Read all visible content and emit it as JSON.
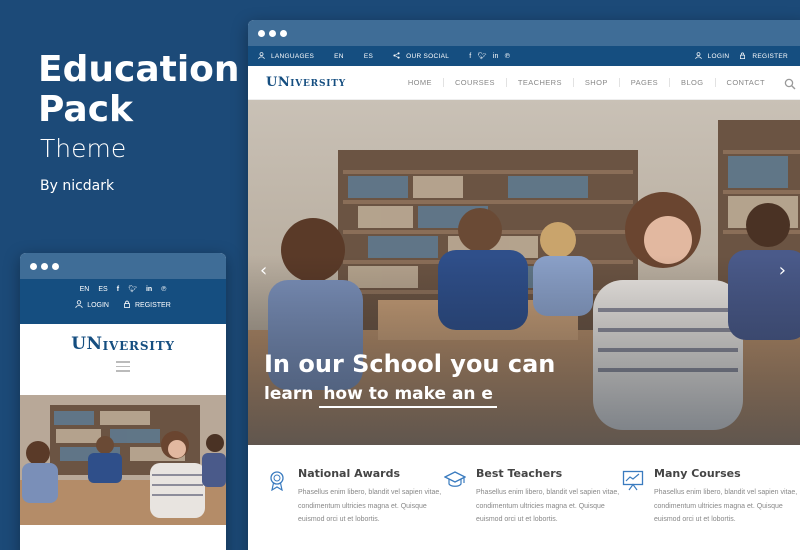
{
  "promo": {
    "title": "Education Pack",
    "subtitle": "Theme",
    "byline": "By nicdark"
  },
  "colors": {
    "background": "#1c4a78",
    "window_bar": "#3f6d97",
    "topbar": "#154e80",
    "brand": "#154e80"
  },
  "desktop": {
    "topbar": {
      "languages_label": "LANGUAGES",
      "lang_en": "EN",
      "lang_es": "ES",
      "social_label": "OUR SOCIAL",
      "login": "LOGIN",
      "register": "REGISTER"
    },
    "logo": {
      "big": "UN",
      "rest": "IVERSITY"
    },
    "menu": [
      "HOME",
      "COURSES",
      "TEACHERS",
      "SHOP",
      "PAGES",
      "BLOG",
      "CONTACT"
    ],
    "hero": {
      "line1": "In our School you can",
      "line2_prefix": "learn",
      "line2_typed": "how to make an e",
      "prev_arrow": "‹",
      "next_arrow": "›"
    },
    "features": [
      {
        "title": "National Awards",
        "icon": "award-icon",
        "text": "Phasellus enim libero, blandit vel sapien vitae, condimentum ultricies magna et. Quisque euismod orci ut et lobortis."
      },
      {
        "title": "Best Teachers",
        "icon": "graduation-cap-icon",
        "text": "Phasellus enim libero, blandit vel sapien vitae, condimentum ultricies magna et. Quisque euismod orci ut et lobortis."
      },
      {
        "title": "Many Courses",
        "icon": "chart-board-icon",
        "text": "Phasellus enim libero, blandit vel sapien vitae, condimentum ultricies magna et. Quisque euismod orci ut et lobortis."
      }
    ]
  },
  "mobile": {
    "lang_en": "EN",
    "lang_es": "ES",
    "login": "LOGIN",
    "register": "REGISTER",
    "logo": {
      "big": "UN",
      "rest": "IVERSITY"
    }
  }
}
